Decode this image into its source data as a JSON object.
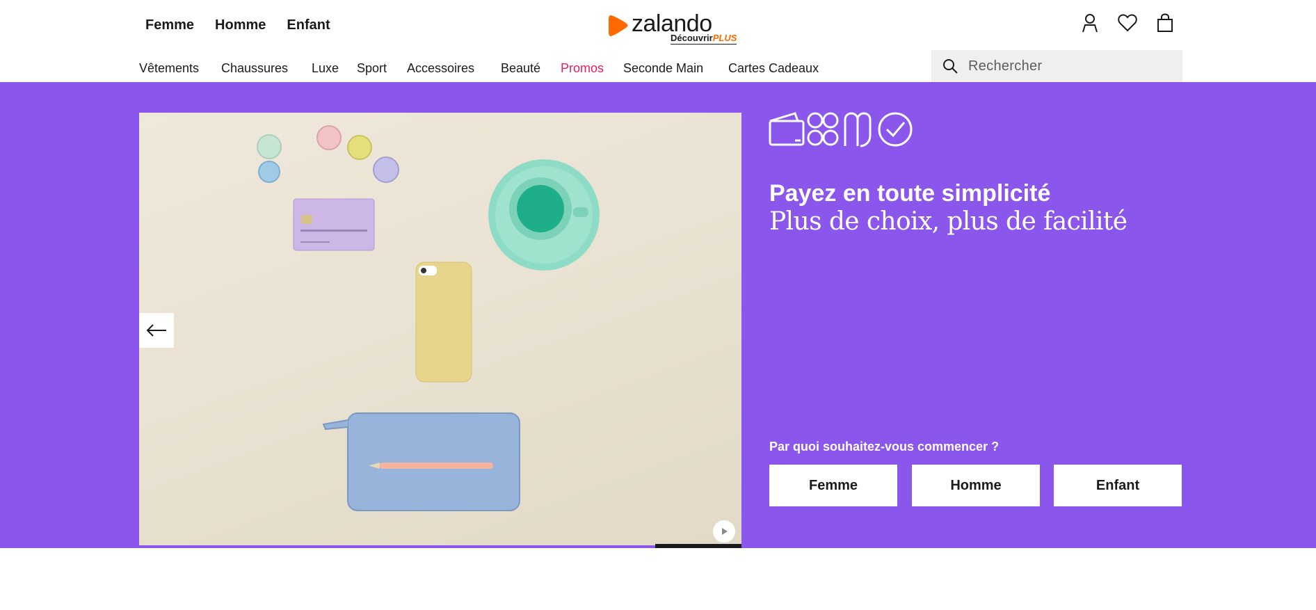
{
  "header": {
    "gender_nav": [
      {
        "label": "Femme"
      },
      {
        "label": "Homme"
      },
      {
        "label": "Enfant"
      }
    ],
    "logo": {
      "brand": "zalando",
      "tagline_prefix": "Découvrir",
      "tagline_plus": "PLUS",
      "brand_color": "#ff6900"
    },
    "icons": [
      "user-icon",
      "heart-icon",
      "bag-icon"
    ],
    "categories": [
      {
        "label": "Vêtements"
      },
      {
        "label": "Chaussures"
      },
      {
        "label": "Luxe"
      },
      {
        "label": "Sport"
      },
      {
        "label": "Accessoires"
      },
      {
        "label": "Beauté"
      },
      {
        "label": "Promos",
        "color": "#e81e63"
      },
      {
        "label": "Seconde Main"
      },
      {
        "label": "Cartes Cadeaux"
      }
    ],
    "search": {
      "placeholder": "Rechercher"
    }
  },
  "hero": {
    "background": "#8b56ec",
    "title": "Payez en toute simplicité",
    "subtitle": "Plus de choix, plus de facilité",
    "question": "Par quoi souhaitez-vous commencer ?",
    "ctas": [
      {
        "label": "Femme"
      },
      {
        "label": "Homme"
      },
      {
        "label": "Enfant"
      }
    ],
    "payment_icons": [
      "wallet-icon",
      "installments-icon",
      "split-icon",
      "check-circle-icon"
    ],
    "image": "Flat-lay photo: coins, lilac payment card, mint cup and saucer, yellow smartphone, blue wallet with pencil on beige background"
  }
}
